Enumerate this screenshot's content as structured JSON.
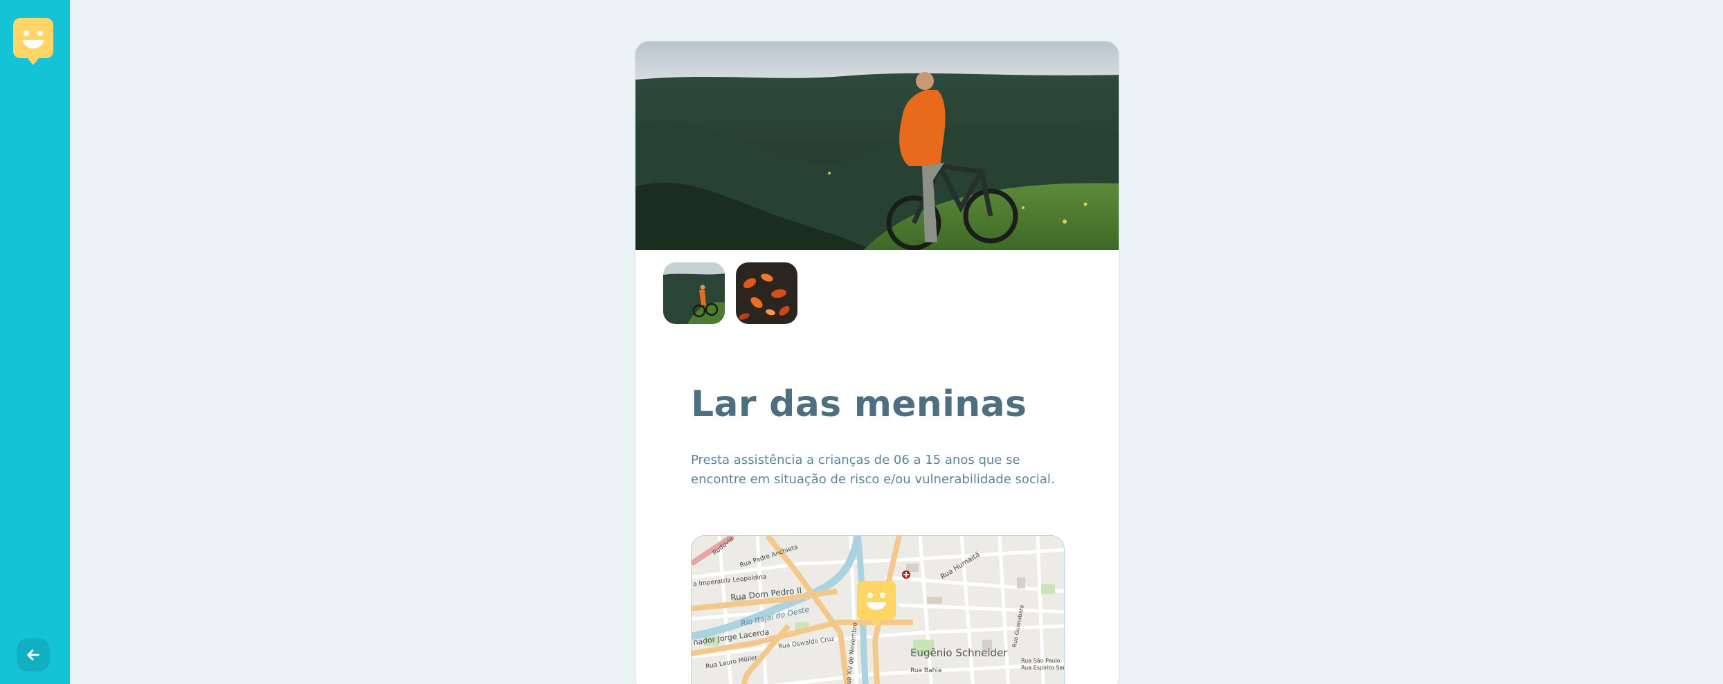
{
  "sidebar": {
    "logo_icon": "happy-face-map-pin-icon",
    "back_icon": "arrow-left-icon"
  },
  "orphanage": {
    "images": [
      {
        "subject": "cyclist-overlooking-forest"
      },
      {
        "subject": "orange-leaves-closeup"
      }
    ],
    "name": "Lar das meninas",
    "about": "Presta assistência a crianças de 06 a 15 anos que se encontre em situação de risco e/ou vulnerabilidade social."
  },
  "map": {
    "marker_icon": "happy-face-map-pin-icon",
    "street_labels": {
      "dom_pedro": "Rua Dom Pedro II",
      "itajai": "Rio Itajaí do Oeste",
      "jorge_lacerda": "nador Jorge Lacerda",
      "eugenio": "Eugênio Schneider",
      "imperatriz": "a Imperatriz Leopoldina",
      "anchieta": "Rua Padre Anchieta",
      "humaita": "Rua Humaitá",
      "oswaldo": "Rua Oswaldo Cruz",
      "lauro": "Rua Lauro Müller",
      "bahia": "Rua Bahia",
      "novembro": "Rua XV de Novembro",
      "rodovia": "Rodovia",
      "guanabara": "Rua Guanabara",
      "sao_paulo": "Rua São Paulo",
      "espirito": "Rua Espírito Santo"
    },
    "colors": {
      "main_road": "#f4c88a",
      "river": "#aad3df",
      "land": "#ecebe6"
    }
  },
  "theme": {
    "sidebar": "#15c3d6",
    "accent": "#ffd666",
    "title": "#4d6f80",
    "text": "#5c8599"
  }
}
